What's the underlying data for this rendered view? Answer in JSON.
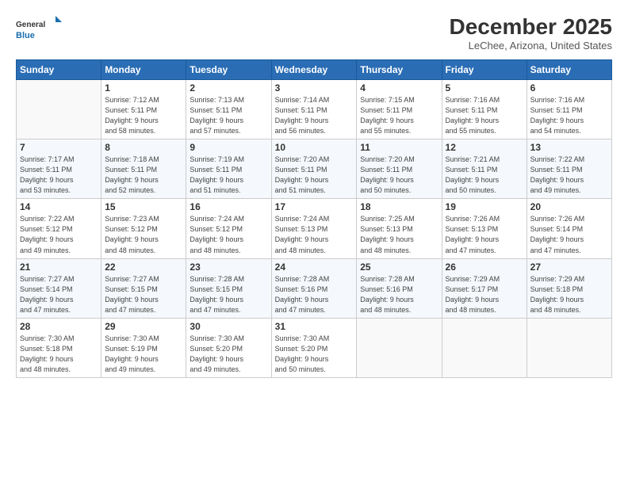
{
  "header": {
    "logo_general": "General",
    "logo_blue": "Blue",
    "month_title": "December 2025",
    "location": "LeChee, Arizona, United States"
  },
  "weekdays": [
    "Sunday",
    "Monday",
    "Tuesday",
    "Wednesday",
    "Thursday",
    "Friday",
    "Saturday"
  ],
  "weeks": [
    [
      {
        "day": "",
        "info": ""
      },
      {
        "day": "1",
        "info": "Sunrise: 7:12 AM\nSunset: 5:11 PM\nDaylight: 9 hours\nand 58 minutes."
      },
      {
        "day": "2",
        "info": "Sunrise: 7:13 AM\nSunset: 5:11 PM\nDaylight: 9 hours\nand 57 minutes."
      },
      {
        "day": "3",
        "info": "Sunrise: 7:14 AM\nSunset: 5:11 PM\nDaylight: 9 hours\nand 56 minutes."
      },
      {
        "day": "4",
        "info": "Sunrise: 7:15 AM\nSunset: 5:11 PM\nDaylight: 9 hours\nand 55 minutes."
      },
      {
        "day": "5",
        "info": "Sunrise: 7:16 AM\nSunset: 5:11 PM\nDaylight: 9 hours\nand 55 minutes."
      },
      {
        "day": "6",
        "info": "Sunrise: 7:16 AM\nSunset: 5:11 PM\nDaylight: 9 hours\nand 54 minutes."
      }
    ],
    [
      {
        "day": "7",
        "info": "Sunrise: 7:17 AM\nSunset: 5:11 PM\nDaylight: 9 hours\nand 53 minutes."
      },
      {
        "day": "8",
        "info": "Sunrise: 7:18 AM\nSunset: 5:11 PM\nDaylight: 9 hours\nand 52 minutes."
      },
      {
        "day": "9",
        "info": "Sunrise: 7:19 AM\nSunset: 5:11 PM\nDaylight: 9 hours\nand 51 minutes."
      },
      {
        "day": "10",
        "info": "Sunrise: 7:20 AM\nSunset: 5:11 PM\nDaylight: 9 hours\nand 51 minutes."
      },
      {
        "day": "11",
        "info": "Sunrise: 7:20 AM\nSunset: 5:11 PM\nDaylight: 9 hours\nand 50 minutes."
      },
      {
        "day": "12",
        "info": "Sunrise: 7:21 AM\nSunset: 5:11 PM\nDaylight: 9 hours\nand 50 minutes."
      },
      {
        "day": "13",
        "info": "Sunrise: 7:22 AM\nSunset: 5:11 PM\nDaylight: 9 hours\nand 49 minutes."
      }
    ],
    [
      {
        "day": "14",
        "info": "Sunrise: 7:22 AM\nSunset: 5:12 PM\nDaylight: 9 hours\nand 49 minutes."
      },
      {
        "day": "15",
        "info": "Sunrise: 7:23 AM\nSunset: 5:12 PM\nDaylight: 9 hours\nand 48 minutes."
      },
      {
        "day": "16",
        "info": "Sunrise: 7:24 AM\nSunset: 5:12 PM\nDaylight: 9 hours\nand 48 minutes."
      },
      {
        "day": "17",
        "info": "Sunrise: 7:24 AM\nSunset: 5:13 PM\nDaylight: 9 hours\nand 48 minutes."
      },
      {
        "day": "18",
        "info": "Sunrise: 7:25 AM\nSunset: 5:13 PM\nDaylight: 9 hours\nand 48 minutes."
      },
      {
        "day": "19",
        "info": "Sunrise: 7:26 AM\nSunset: 5:13 PM\nDaylight: 9 hours\nand 47 minutes."
      },
      {
        "day": "20",
        "info": "Sunrise: 7:26 AM\nSunset: 5:14 PM\nDaylight: 9 hours\nand 47 minutes."
      }
    ],
    [
      {
        "day": "21",
        "info": "Sunrise: 7:27 AM\nSunset: 5:14 PM\nDaylight: 9 hours\nand 47 minutes."
      },
      {
        "day": "22",
        "info": "Sunrise: 7:27 AM\nSunset: 5:15 PM\nDaylight: 9 hours\nand 47 minutes."
      },
      {
        "day": "23",
        "info": "Sunrise: 7:28 AM\nSunset: 5:15 PM\nDaylight: 9 hours\nand 47 minutes."
      },
      {
        "day": "24",
        "info": "Sunrise: 7:28 AM\nSunset: 5:16 PM\nDaylight: 9 hours\nand 47 minutes."
      },
      {
        "day": "25",
        "info": "Sunrise: 7:28 AM\nSunset: 5:16 PM\nDaylight: 9 hours\nand 48 minutes."
      },
      {
        "day": "26",
        "info": "Sunrise: 7:29 AM\nSunset: 5:17 PM\nDaylight: 9 hours\nand 48 minutes."
      },
      {
        "day": "27",
        "info": "Sunrise: 7:29 AM\nSunset: 5:18 PM\nDaylight: 9 hours\nand 48 minutes."
      }
    ],
    [
      {
        "day": "28",
        "info": "Sunrise: 7:30 AM\nSunset: 5:18 PM\nDaylight: 9 hours\nand 48 minutes."
      },
      {
        "day": "29",
        "info": "Sunrise: 7:30 AM\nSunset: 5:19 PM\nDaylight: 9 hours\nand 49 minutes."
      },
      {
        "day": "30",
        "info": "Sunrise: 7:30 AM\nSunset: 5:20 PM\nDaylight: 9 hours\nand 49 minutes."
      },
      {
        "day": "31",
        "info": "Sunrise: 7:30 AM\nSunset: 5:20 PM\nDaylight: 9 hours\nand 50 minutes."
      },
      {
        "day": "",
        "info": ""
      },
      {
        "day": "",
        "info": ""
      },
      {
        "day": "",
        "info": ""
      }
    ]
  ]
}
